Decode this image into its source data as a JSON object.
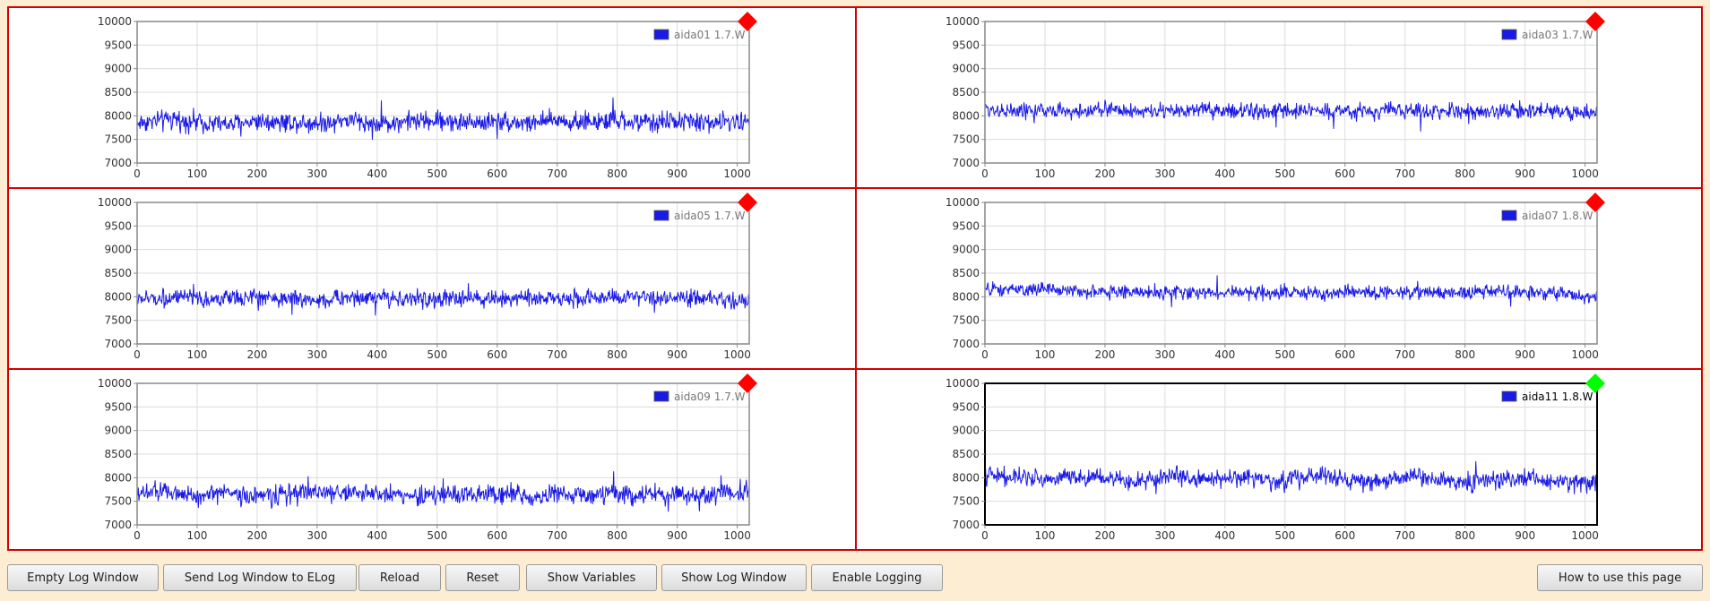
{
  "colors": {
    "background": "#fdedd3",
    "panel_border": "#d40000",
    "series": "#1a1ae6",
    "status_alarm": "#ff0000",
    "status_ok": "#00ff00",
    "plot_frame_inactive": "#888888",
    "plot_frame_active": "#000000"
  },
  "panels": [
    {
      "legend": "aida01 1.7.W",
      "status": "alarm",
      "status_icon": "red-diamond-icon",
      "active": false,
      "chart_data": {
        "type": "line",
        "xlim": [
          0,
          1020
        ],
        "ylim": [
          7000,
          10000
        ],
        "grid": true,
        "legend_position": "top-right",
        "x_ticks": [
          "0",
          "100",
          "200",
          "300",
          "400",
          "500",
          "600",
          "700",
          "800",
          "900",
          "1000"
        ],
        "y_ticks": [
          "10000",
          "9500",
          "9000",
          "8500",
          "8000",
          "7500",
          "7000"
        ],
        "series": [
          {
            "name": "aida01 1.7.W",
            "mean": 7880,
            "amplitude": 380,
            "values_every_50": [
              7850,
              7920,
              7880,
              7810,
              7900,
              7870,
              7850,
              7920,
              7830,
              7880,
              7900,
              7860,
              7890,
              7840,
              7910,
              7870,
              7880,
              7860,
              7900,
              7850,
              7880
            ]
          }
        ]
      }
    },
    {
      "legend": "aida03 1.7.W",
      "status": "alarm",
      "status_icon": "red-diamond-icon",
      "active": false,
      "chart_data": {
        "type": "line",
        "xlim": [
          0,
          1020
        ],
        "ylim": [
          7000,
          10000
        ],
        "grid": true,
        "legend_position": "top-right",
        "x_ticks": [
          "0",
          "100",
          "200",
          "300",
          "400",
          "500",
          "600",
          "700",
          "800",
          "900",
          "1000"
        ],
        "y_ticks": [
          "10000",
          "9500",
          "9000",
          "8500",
          "8000",
          "7500",
          "7000"
        ],
        "series": [
          {
            "name": "aida03 1.7.W",
            "mean": 8100,
            "amplitude": 300,
            "values_every_50": [
              8150,
              8100,
              8120,
              8080,
              8150,
              8100,
              8090,
              8120,
              8110,
              8080,
              8100,
              8130,
              8090,
              8100,
              8120,
              8090,
              8110,
              8080,
              8100,
              8120,
              8050
            ]
          }
        ]
      }
    },
    {
      "legend": "aida05 1.7.W",
      "status": "alarm",
      "status_icon": "red-diamond-icon",
      "active": false,
      "chart_data": {
        "type": "line",
        "xlim": [
          0,
          1020
        ],
        "ylim": [
          7000,
          10000
        ],
        "grid": true,
        "legend_position": "top-right",
        "x_ticks": [
          "0",
          "100",
          "200",
          "300",
          "400",
          "500",
          "600",
          "700",
          "800",
          "900",
          "1000"
        ],
        "y_ticks": [
          "10000",
          "9500",
          "9000",
          "8500",
          "8000",
          "7500",
          "7000"
        ],
        "series": [
          {
            "name": "aida05 1.7.W",
            "mean": 7960,
            "amplitude": 320,
            "values_every_50": [
              7950,
              7980,
              7940,
              7960,
              8000,
              7950,
              7930,
              7970,
              7990,
              7960,
              7940,
              7980,
              7950,
              7990,
              7960,
              7970,
              7980,
              7960,
              7950,
              7970,
              7900
            ]
          }
        ]
      }
    },
    {
      "legend": "aida07 1.8.W",
      "status": "alarm",
      "status_icon": "red-diamond-icon",
      "active": false,
      "chart_data": {
        "type": "line",
        "xlim": [
          0,
          1020
        ],
        "ylim": [
          7000,
          10000
        ],
        "grid": true,
        "legend_position": "top-right",
        "x_ticks": [
          "0",
          "100",
          "200",
          "300",
          "400",
          "500",
          "600",
          "700",
          "800",
          "900",
          "1000"
        ],
        "y_ticks": [
          "10000",
          "9500",
          "9000",
          "8500",
          "8000",
          "7500",
          "7000"
        ],
        "series": [
          {
            "name": "aida07 1.8.W",
            "mean": 8090,
            "amplitude": 260,
            "values_every_50": [
              8150,
              8140,
              8160,
              8130,
              8110,
              8100,
              8090,
              8080,
              8100,
              8080,
              8070,
              8090,
              8080,
              8090,
              8100,
              8080,
              8090,
              8110,
              8100,
              8090,
              8000
            ]
          }
        ]
      }
    },
    {
      "legend": "aida09 1.7.W",
      "status": "alarm",
      "status_icon": "red-diamond-icon",
      "active": false,
      "chart_data": {
        "type": "line",
        "xlim": [
          0,
          1020
        ],
        "ylim": [
          7000,
          10000
        ],
        "grid": true,
        "legend_position": "top-right",
        "x_ticks": [
          "0",
          "100",
          "200",
          "300",
          "400",
          "500",
          "600",
          "700",
          "800",
          "900",
          "1000"
        ],
        "y_ticks": [
          "10000",
          "9500",
          "9000",
          "8500",
          "8000",
          "7500",
          "7000"
        ],
        "series": [
          {
            "name": "aida09 1.7.W",
            "mean": 7650,
            "amplitude": 380,
            "values_every_50": [
              7650,
              7700,
              7620,
              7680,
              7600,
              7650,
              7700,
              7680,
              7660,
              7640,
              7620,
              7650,
              7680,
              7620,
              7650,
              7640,
              7660,
              7630,
              7650,
              7620,
              7700
            ]
          }
        ]
      }
    },
    {
      "legend": "aida11 1.8.W",
      "status": "ok",
      "status_icon": "green-diamond-icon",
      "active": true,
      "chart_data": {
        "type": "line",
        "xlim": [
          0,
          1020
        ],
        "ylim": [
          7000,
          10000
        ],
        "grid": true,
        "legend_position": "top-right",
        "x_ticks": [
          "0",
          "100",
          "200",
          "300",
          "400",
          "500",
          "600",
          "700",
          "800",
          "900",
          "1000"
        ],
        "y_ticks": [
          "10000",
          "9500",
          "9000",
          "8500",
          "8000",
          "7500",
          "7000"
        ],
        "series": [
          {
            "name": "aida11 1.8.W",
            "mean": 7950,
            "amplitude": 340,
            "values_every_50": [
              8050,
              8000,
              7950,
              8050,
              7980,
              7920,
              8060,
              8000,
              7950,
              8000,
              7900,
              8080,
              7950,
              7900,
              8020,
              7980,
              7880,
              7950,
              8000,
              7920,
              7900
            ]
          }
        ]
      }
    }
  ],
  "toolbar": {
    "empty_log": "Empty Log Window",
    "send_log": "Send Log Window to ELog",
    "reload": "Reload",
    "reset": "Reset",
    "show_variables": "Show Variables",
    "show_log": "Show Log Window",
    "enable_logging": "Enable Logging",
    "how_to": "How to use this page"
  }
}
